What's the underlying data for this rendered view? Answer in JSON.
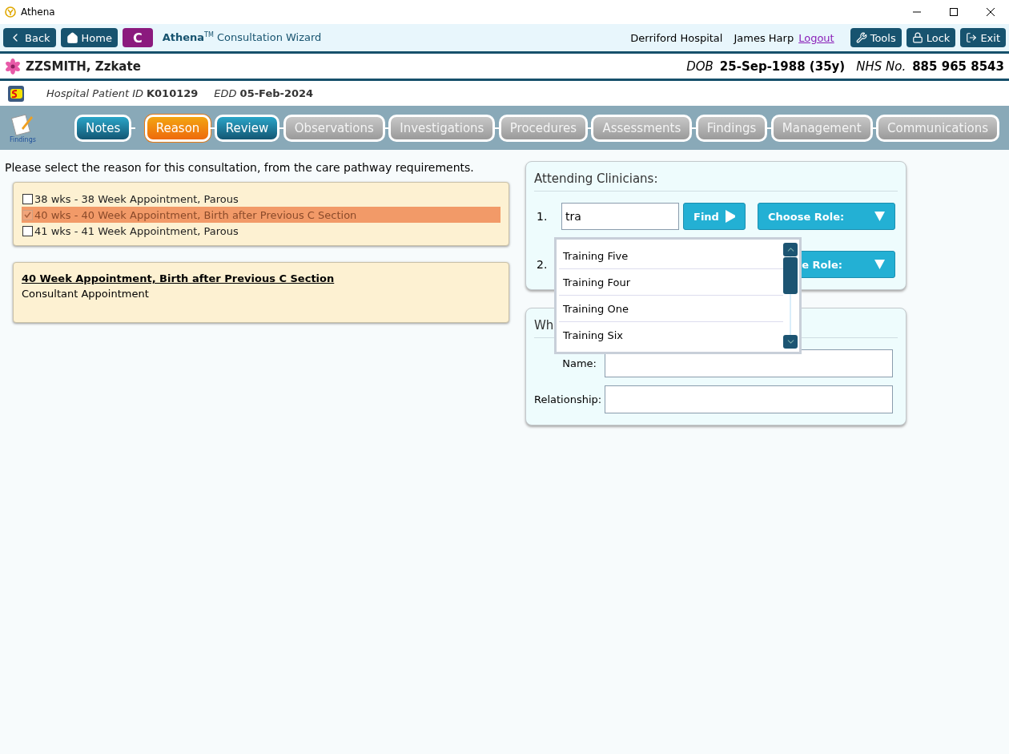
{
  "window": {
    "title": "Athena"
  },
  "toolbar": {
    "back": "Back",
    "home": "Home",
    "badge": "C",
    "app_name": "Athena",
    "app_mark": "TM",
    "app_title": "Consultation Wizard",
    "location": "Derriford Hospital",
    "user": "James Harp",
    "logout": "Logout",
    "buttons": [
      {
        "kind": "tools",
        "label": "Tools"
      },
      {
        "kind": "lock",
        "label": "Lock"
      },
      {
        "kind": "exit",
        "label": "Exit"
      }
    ]
  },
  "patient": {
    "name": "ZZSMITH, Zzkate",
    "dob_label": "DOB",
    "dob": "25-Sep-1988 (35y)",
    "nhs_label": "NHS No.",
    "nhs": "885 965 8543"
  },
  "info": {
    "id_label": "Hospital Patient ID",
    "id": "K010129",
    "edd_label": "EDD",
    "edd": "05-Feb-2024"
  },
  "steps": {
    "caption": "Findings",
    "items": [
      {
        "label": "Notes",
        "kind": "done",
        "selected": false
      },
      {
        "label": "Reason",
        "kind": "current",
        "selected": true
      },
      {
        "label": "Review",
        "kind": "done",
        "selected": false
      },
      {
        "label": "Observations",
        "kind": "pending",
        "selected": false
      },
      {
        "label": "Investigations",
        "kind": "pending",
        "selected": false
      },
      {
        "label": "Procedures",
        "kind": "pending",
        "selected": false
      },
      {
        "label": "Assessments",
        "kind": "pending",
        "selected": false
      },
      {
        "label": "Findings",
        "kind": "pending",
        "selected": false
      },
      {
        "label": "Management",
        "kind": "pending",
        "selected": false
      },
      {
        "label": "Communications",
        "kind": "pending",
        "selected": false
      }
    ]
  },
  "instruction": "Please select the reason for this consultation, from the care pathway requirements.",
  "reasons": [
    {
      "label": "38 wks - 38 Week Appointment, Parous",
      "checked": false,
      "selected": false
    },
    {
      "label": "40 wks - 40 Week Appointment, Birth after Previous C Section",
      "checked": true,
      "selected": true
    },
    {
      "label": "41 wks - 41 Week Appointment, Parous",
      "checked": false,
      "selected": false
    }
  ],
  "detail": {
    "title": "40 Week Appointment, Birth after Previous C Section",
    "subtitle": "Consultant Appointment"
  },
  "clinicians": {
    "title": "Attending Clinicians:",
    "rows": [
      {
        "number": "1.",
        "value": "tra",
        "find": "Find",
        "role": "Choose Role:"
      },
      {
        "number": "2.",
        "role": "e Role:"
      }
    ]
  },
  "suggestions": [
    "Training Five",
    "Training Four",
    "Training One",
    "Training Six"
  ],
  "companion": {
    "title": "Wh",
    "fields": [
      {
        "label": "Name:"
      },
      {
        "label": "Relationship:"
      }
    ]
  }
}
